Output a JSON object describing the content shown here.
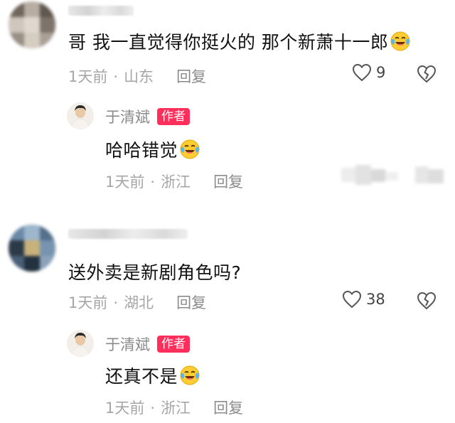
{
  "comments": [
    {
      "text": "哥 我一直觉得你挺火的 那个新萧十一郎",
      "time": "1天前",
      "location": "山东",
      "reply_label": "回复",
      "likes": "9",
      "emoji": "crying-laughing-face",
      "reply": {
        "author": "于清斌",
        "badge": "作者",
        "text": "哈哈错觉",
        "emoji": "crying-laughing-face",
        "time": "1天前",
        "location": "浙江",
        "reply_label": "回复"
      }
    },
    {
      "text": "送外卖是新剧角色吗?",
      "time": "1天前",
      "location": "湖北",
      "reply_label": "回复",
      "likes": "38",
      "reply": {
        "author": "于清斌",
        "badge": "作者",
        "text": "还真不是",
        "emoji": "crying-laughing-face",
        "time": "1天前",
        "location": "浙江",
        "reply_label": "回复"
      }
    }
  ],
  "colors": {
    "badge": "#ff2e5a",
    "meta": "#a6a6a6"
  }
}
